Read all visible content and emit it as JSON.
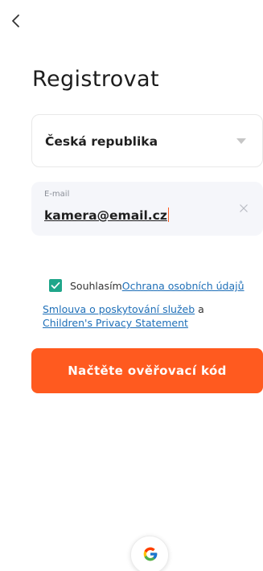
{
  "header": {
    "back_icon": "chevron-left-icon",
    "title": "Registrovat"
  },
  "country": {
    "value": "Česká republika",
    "icon": "caret-down-icon"
  },
  "email": {
    "label": "E-mail",
    "value": "kamera@email.cz",
    "clear_icon": "close-icon"
  },
  "agreement": {
    "checked": true,
    "prefix": "Souhlasím",
    "privacy_link": "Ochrana osobních údajů",
    "terms_link": "Smlouva o poskytování služeb",
    "conjunction": " a",
    "children_link": "Children's Privacy Statement"
  },
  "cta": {
    "label": "Načtěte ověřovací kód"
  },
  "social": {
    "google_icon": "google-icon"
  },
  "colors": {
    "accent": "#ff5a1f",
    "checkbox": "#1fa68a",
    "link": "#1e6fb8",
    "input_bg": "#f5f6fa"
  }
}
